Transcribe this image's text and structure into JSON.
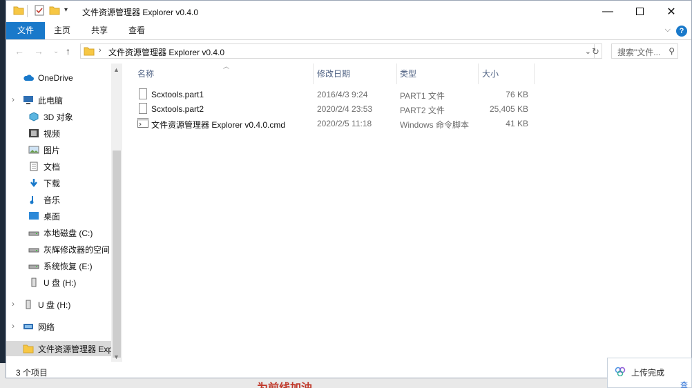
{
  "window": {
    "title": "文件资源管理器 Explorer v0.4.0",
    "minimize_icon": "minimize-icon",
    "maximize_icon": "maximize-icon",
    "close_icon": "close-icon"
  },
  "ribbon": {
    "tabs": [
      "文件",
      "主页",
      "共享",
      "查看"
    ],
    "help": "?",
    "collapse": "⌵"
  },
  "address": {
    "path": "文件资源管理器 Explorer v0.4.0",
    "search_placeholder": "搜索\"文件..."
  },
  "nav": {
    "items": [
      {
        "label": "OneDrive",
        "icon": "cloud-icon"
      },
      {
        "label": "此电脑",
        "icon": "computer-icon"
      },
      {
        "label": "3D 对象",
        "icon": "3d-objects-icon"
      },
      {
        "label": "视频",
        "icon": "video-icon"
      },
      {
        "label": "图片",
        "icon": "pictures-icon"
      },
      {
        "label": "文档",
        "icon": "documents-icon"
      },
      {
        "label": "下载",
        "icon": "download-icon"
      },
      {
        "label": "音乐",
        "icon": "music-icon"
      },
      {
        "label": "桌面",
        "icon": "desktop-icon"
      },
      {
        "label": "本地磁盘 (C:)",
        "icon": "drive-icon"
      },
      {
        "label": "灰辉修改器的空间",
        "icon": "drive-icon"
      },
      {
        "label": "系统恢复 (E:)",
        "icon": "drive-icon"
      },
      {
        "label": "U 盘 (H:)",
        "icon": "usb-icon"
      },
      {
        "label": "U 盘 (H:)",
        "icon": "usb-icon"
      },
      {
        "label": "网络",
        "icon": "network-icon"
      },
      {
        "label": "文件资源管理器 Exp",
        "icon": "folder-icon"
      }
    ]
  },
  "columns": {
    "name": "名称",
    "date": "修改日期",
    "type": "类型",
    "size": "大小"
  },
  "files": [
    {
      "name": "Scxtools.part1",
      "date": "2016/4/3 9:24",
      "type": "PART1 文件",
      "size": "76 KB"
    },
    {
      "name": "Scxtools.part2",
      "date": "2020/2/4 23:53",
      "type": "PART2 文件",
      "size": "25,405 KB"
    },
    {
      "name": "文件资源管理器 Explorer v0.4.0.cmd",
      "date": "2020/2/5 11:18",
      "type": "Windows 命令脚本",
      "size": "41 KB"
    }
  ],
  "status": {
    "count": "3 个项目"
  },
  "toast": {
    "text": "上传完成",
    "link": "查看"
  },
  "background": {
    "red_text": "为前线加油"
  },
  "colors": {
    "accent": "#1979ca",
    "folder": "#f7c744"
  }
}
